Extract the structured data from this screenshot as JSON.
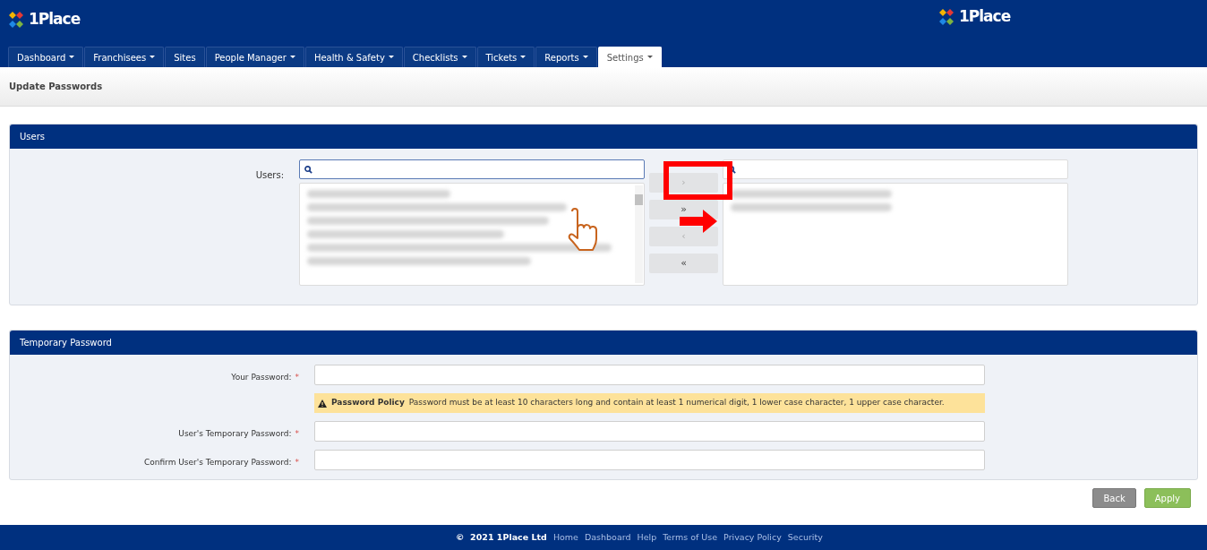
{
  "header": {
    "logo": "1Place",
    "logo_right": "1Place"
  },
  "nav_tabs": [
    {
      "label": "Dashboard",
      "dropdown": true,
      "selected": false
    },
    {
      "label": "Franchisees",
      "dropdown": true,
      "selected": false
    },
    {
      "label": "Sites",
      "dropdown": false,
      "selected": false
    },
    {
      "label": "People Manager",
      "dropdown": true,
      "selected": false
    },
    {
      "label": "Health & Safety",
      "dropdown": true,
      "selected": false
    },
    {
      "label": "Checklists",
      "dropdown": true,
      "selected": false
    },
    {
      "label": "Tickets",
      "dropdown": true,
      "selected": false
    },
    {
      "label": "Reports",
      "dropdown": true,
      "selected": false
    },
    {
      "label": "Settings",
      "dropdown": true,
      "selected": true
    }
  ],
  "page_title": "Update Passwords",
  "users_panel": {
    "title": "Users",
    "label": "Users:",
    "move_buttons": [
      {
        "label": "›",
        "disabled": true
      },
      {
        "label": "»",
        "disabled": false
      },
      {
        "label": "‹",
        "disabled": true
      },
      {
        "label": "«",
        "disabled": false
      }
    ]
  },
  "password_panel": {
    "title": "Temporary Password",
    "fields": [
      {
        "kind": "input",
        "label": "Your Password:",
        "required_mark": "*"
      },
      {
        "kind": "notice",
        "title": "Password Policy",
        "text": "Password must be at least 10 characters long and contain at least 1 numerical digit, 1 lower case character, 1 upper case character."
      },
      {
        "kind": "input",
        "label": "User's Temporary Password:",
        "required_mark": "*"
      },
      {
        "kind": "input",
        "label": "Confirm User's Temporary Password:",
        "required_mark": "*"
      }
    ]
  },
  "buttons": [
    {
      "label": "Back",
      "kind": "secondary"
    },
    {
      "label": "Apply",
      "kind": "primary"
    }
  ],
  "footer": {
    "copyright": "©  2021 1Place Ltd",
    "links": [
      "Home",
      "Dashboard",
      "Help",
      "Terms of Use",
      "Privacy Policy",
      "Security"
    ]
  }
}
